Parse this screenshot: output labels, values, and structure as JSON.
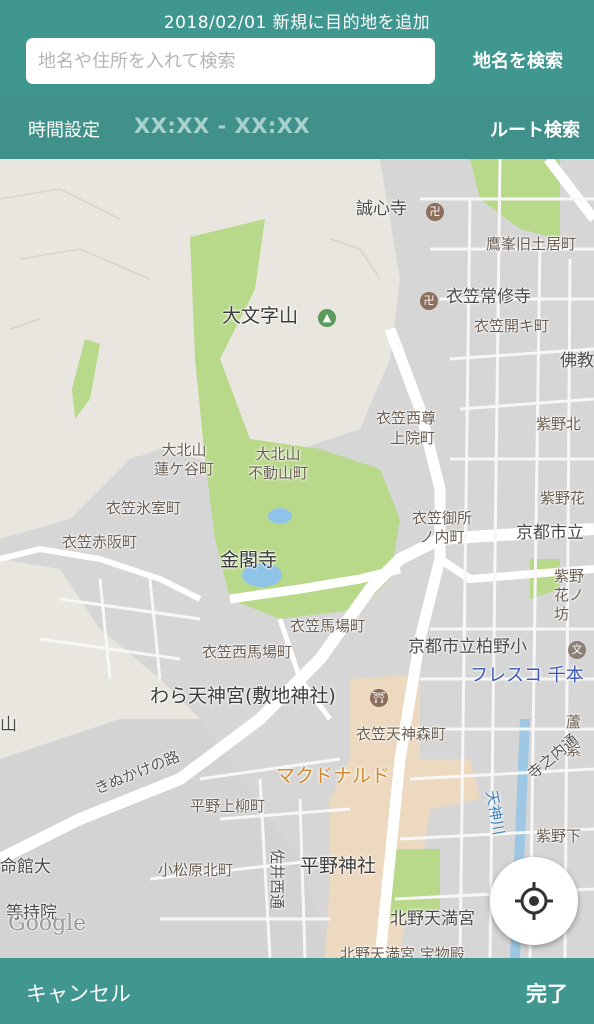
{
  "header": {
    "title": "2018/02/01  新規に目的地を追加",
    "search_placeholder": "地名や住所を入れて検索",
    "search_button": "地名を検索"
  },
  "time_bar": {
    "label": "時間設定",
    "range": "XX:XX - XX:XX",
    "route_button": "ルート検索"
  },
  "map": {
    "labels": {
      "seishinji": "誠心寺",
      "takamine": "鷹峯旧土居町",
      "kinugasa_tsuneshu": "衣笠常修寺",
      "kinugasa_kaiki": "衣笠開キ町",
      "daimonjiyama": "大文字山",
      "butsukyo": "佛教",
      "kinugasa_nishison": "衣笠西尊",
      "joinmachi": "上院町",
      "shiyakita": "紫野北",
      "okitayama_rengedani": "大北山\n蓮ケ谷町",
      "okitayama_fudo": "大北山\n不動山町",
      "kinugasa_himuro": "衣笠氷室町",
      "kinugasa_akasaka": "衣笠赤阪町",
      "kinugasa_gosho": "衣笠御所\nノ内町",
      "shiyano_r": "紫野花",
      "kyoto_shiritsu": "京都市立",
      "kinkakuji": "金閣寺",
      "shiyano_hana": "紫野\n花ノ坊",
      "kinugasa_baba": "衣笠馬場町",
      "kinugasa_nishibaba": "衣笠西馬場町",
      "kashiwano": "京都市立柏野小",
      "waratenjin": "わら天神宮(敷地神社)",
      "fresco": "フレスコ 千本",
      "kinugasa_tenjinmori": "衣笠天神森町",
      "ro": "蘆",
      "shi_r": "紫",
      "kinukake": "きぬかけの路",
      "mcdonalds": "マクドナルド",
      "teranouchi": "寺之内通",
      "hirano_kamiyanagi": "平野上柳町",
      "tenjingawa": "天神川",
      "shiyashimo": "紫野下",
      "ritsumeikan": "命館大",
      "komatsubara": "小松原北町",
      "sainishi": "佐井西通",
      "hirano_jinja": "平野神社",
      "toujiin": "等持院",
      "kitano_tenmangu": "北野天満宮",
      "kitano_homotsuden": "北野天満宮 宝物殿",
      "left_yama": "山",
      "google": "Google"
    },
    "colors": {
      "park": "#b9d98a",
      "road": "#ffffff",
      "urban": "#d9d9d9",
      "land": "#e9e6df",
      "water": "#8fc3e8",
      "commercial": "#f3dcbf"
    }
  },
  "footer": {
    "cancel": "キャンセル",
    "done": "完了"
  }
}
